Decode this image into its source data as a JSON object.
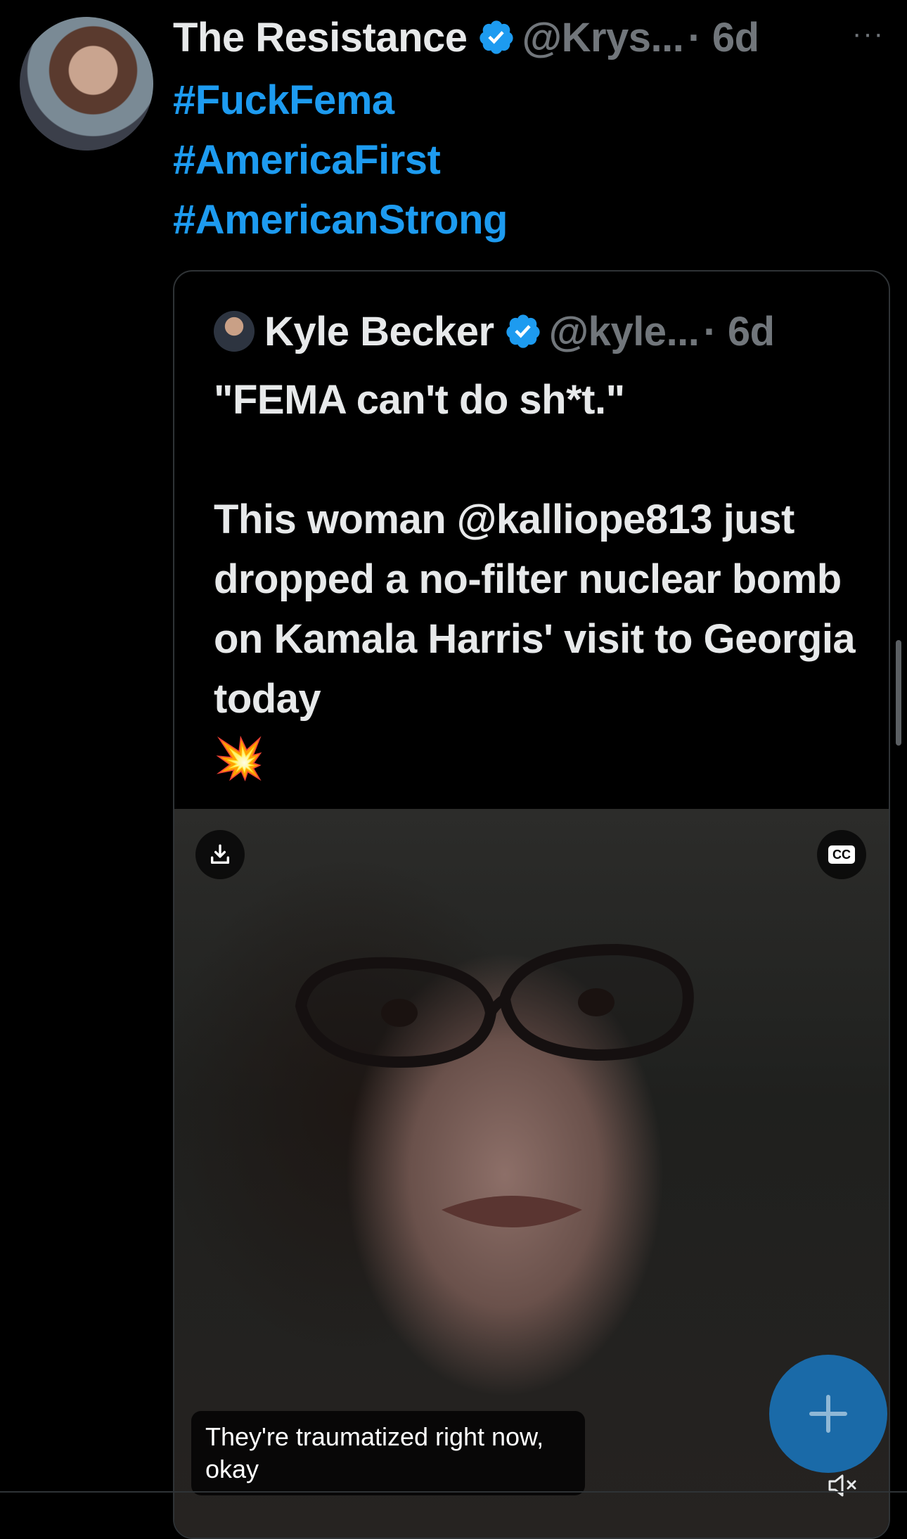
{
  "post": {
    "display_name": "The Resistance",
    "handle": "@Krys...",
    "time": "· 6d",
    "more_label": "···",
    "hashtags": [
      "#FuckFema",
      "#AmericaFirst",
      "#AmericanStrong"
    ]
  },
  "quoted_post": {
    "display_name": "Kyle Becker",
    "handle": "@kyle...",
    "time": "· 6d",
    "line1": "\"FEMA can't do sh*t.\"",
    "line2": "This woman @kalliope813 just dropped a no-filter nuclear bomb on Kamala Harris' visit to Georgia today",
    "emoji": "💥"
  },
  "video": {
    "caption": "They're traumatized right now, okay",
    "download_icon": "download-icon",
    "cc_label": "CC",
    "mute_icon": "muted-speaker-icon"
  },
  "fab": {
    "icon": "plus-icon"
  },
  "colors": {
    "background": "#000000",
    "text": "#e7e9ea",
    "muted": "#71767b",
    "link": "#1d9bf0",
    "fab": "#1a6aa8",
    "border": "#2f3336"
  }
}
